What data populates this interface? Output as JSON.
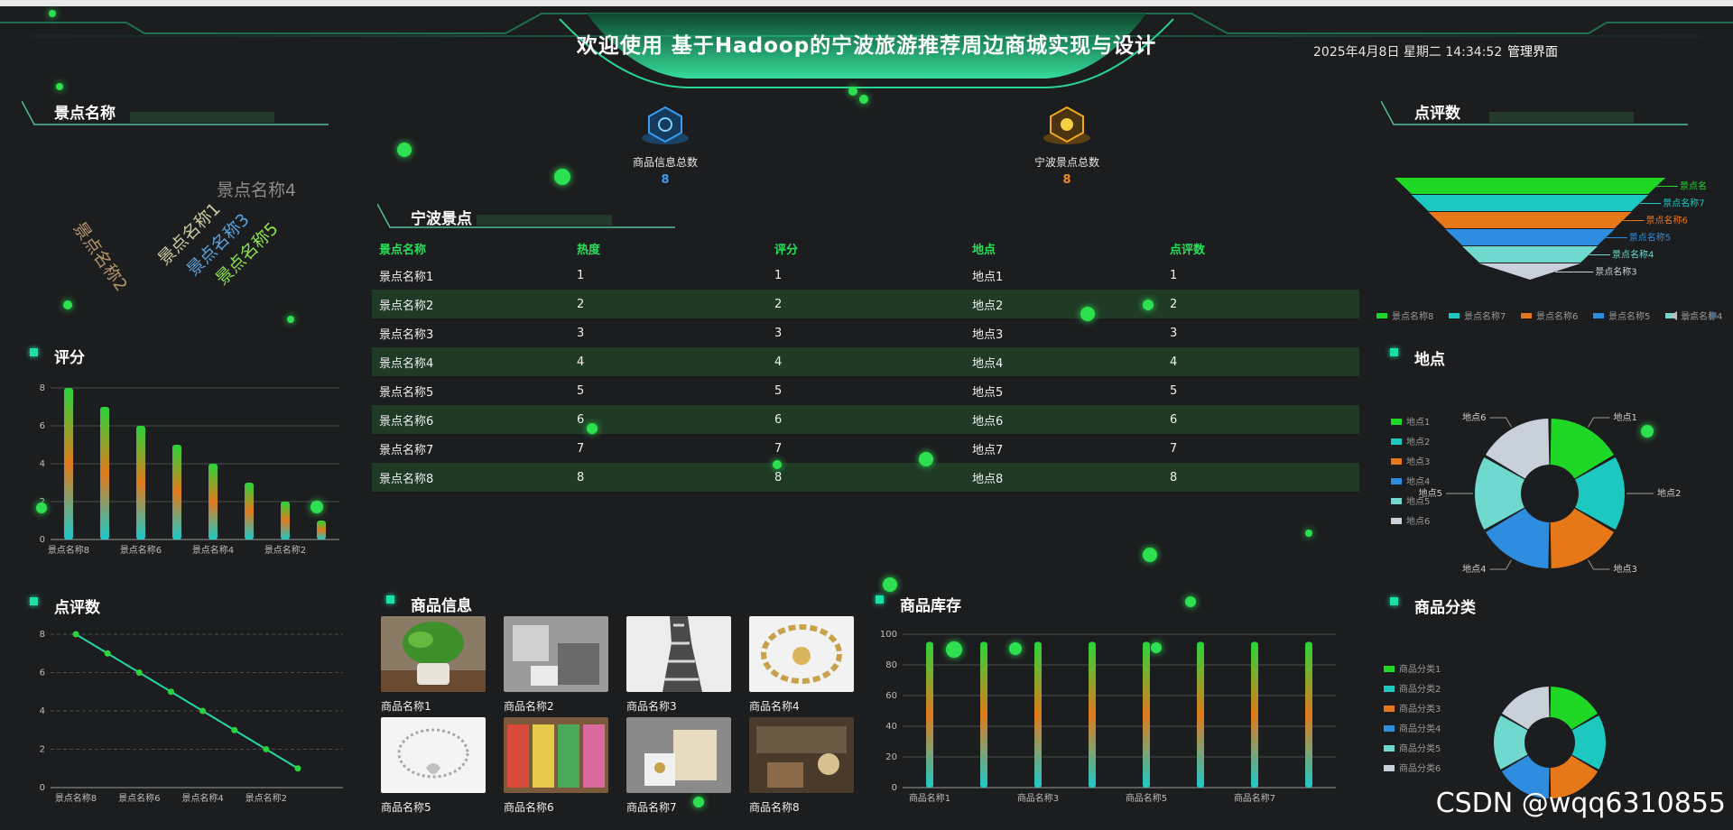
{
  "header": {
    "title": "欢迎使用 基于Hadoop的宁波旅游推荐周边商城实现与设计",
    "datetime": "2025年4月8日 星期二 14:34:52",
    "admin_link": "管理界面"
  },
  "panels": {
    "spot_name": "景点名称",
    "rating": "评分",
    "review_count_left": "点评数",
    "ningbo_spots": "宁波景点",
    "goods_info": "商品信息",
    "goods_stock": "商品库存",
    "review_count_right": "点评数",
    "location": "地点",
    "goods_category": "商品分类"
  },
  "stats": [
    {
      "label": "商品信息总数",
      "value": "8",
      "color": "#3a9cf0",
      "icon": "goods-hex-icon"
    },
    {
      "label": "宁波景点总数",
      "value": "8",
      "color": "#f08a1c",
      "icon": "spot-hex-icon"
    }
  ],
  "wordcloud": [
    {
      "text": "景点名称4",
      "color": "#8c8c8c"
    },
    {
      "text": "景点名称2",
      "color": "#b59468"
    },
    {
      "text": "景点名称1",
      "color": "#c9c9a0"
    },
    {
      "text": "景点名称3",
      "color": "#5aa0d8"
    },
    {
      "text": "景点名称5",
      "color": "#8ce04c"
    }
  ],
  "table": {
    "headers": [
      "景点名称",
      "热度",
      "评分",
      "地点",
      "点评数"
    ],
    "rows": [
      [
        "景点名称1",
        "1",
        "1",
        "地点1",
        "1"
      ],
      [
        "景点名称2",
        "2",
        "2",
        "地点2",
        "2"
      ],
      [
        "景点名称3",
        "3",
        "3",
        "地点3",
        "3"
      ],
      [
        "景点名称4",
        "4",
        "4",
        "地点4",
        "4"
      ],
      [
        "景点名称5",
        "5",
        "5",
        "地点5",
        "5"
      ],
      [
        "景点名称6",
        "6",
        "6",
        "地点6",
        "6"
      ],
      [
        "景点名称7",
        "7",
        "7",
        "地点7",
        "7"
      ],
      [
        "景点名称8",
        "8",
        "8",
        "地点8",
        "8"
      ]
    ]
  },
  "goods": [
    {
      "name": "商品名称1",
      "img": "plant"
    },
    {
      "name": "商品名称2",
      "img": "gray-photo"
    },
    {
      "name": "商品名称3",
      "img": "dress"
    },
    {
      "name": "商品名称4",
      "img": "bracelet-gold"
    },
    {
      "name": "商品名称5",
      "img": "bracelet-silver"
    },
    {
      "name": "商品名称6",
      "img": "market"
    },
    {
      "name": "商品名称7",
      "img": "box"
    },
    {
      "name": "商品名称8",
      "img": "shop"
    }
  ],
  "chart_data": [
    {
      "id": "rating-bar",
      "type": "bar",
      "categories": [
        "景点名称8",
        "景点名称7",
        "景点名称6",
        "景点名称5",
        "景点名称4",
        "景点名称3",
        "景点名称2",
        "景点名称1"
      ],
      "values": [
        8,
        7,
        6,
        5,
        4,
        3,
        2,
        1
      ],
      "xtick_labels": [
        "景点名称8",
        "景点名称6",
        "景点名称4",
        "景点名称2"
      ],
      "yticks": [
        "0",
        "2",
        "4",
        "6",
        "8"
      ],
      "ylim": [
        0,
        8
      ]
    },
    {
      "id": "review-line",
      "type": "line",
      "categories": [
        "景点名称8",
        "景点名称7",
        "景点名称6",
        "景点名称5",
        "景点名称4",
        "景点名称3",
        "景点名称2",
        "景点名称1"
      ],
      "values": [
        8,
        7,
        6,
        5,
        4,
        3,
        2,
        1
      ],
      "xtick_labels": [
        "景点名称8",
        "景点名称6",
        "景点名称4",
        "景点名称2"
      ],
      "yticks": [
        "0",
        "2",
        "4",
        "6",
        "8"
      ],
      "ylim": [
        0,
        8
      ]
    },
    {
      "id": "stock-bar",
      "type": "bar",
      "categories": [
        "商品名称1",
        "商品名称2",
        "商品名称3",
        "商品名称4",
        "商品名称5",
        "商品名称6",
        "商品名称7",
        "商品名称8"
      ],
      "values": [
        95,
        95,
        95,
        95,
        95,
        95,
        95,
        95
      ],
      "xtick_labels": [
        "商品名称1",
        "商品名称3",
        "商品名称5",
        "商品名称7"
      ],
      "yticks": [
        "0",
        "20",
        "40",
        "60",
        "80",
        "100"
      ],
      "ylim": [
        0,
        100
      ]
    },
    {
      "id": "review-funnel",
      "type": "funnel",
      "categories": [
        "景点名称8",
        "景点名称7",
        "景点名称6",
        "景点名称5",
        "景点名称4",
        "景点名称3"
      ],
      "values": [
        8,
        7,
        6,
        5,
        4,
        3
      ],
      "labels": [
        "景点名",
        "景点名称7",
        "景点名称6",
        "景点名称5",
        "景点名称4",
        "景点名称3"
      ],
      "legend": [
        "景点名称8",
        "景点名称7",
        "景点名称6",
        "景点名称5",
        "景点名称4"
      ],
      "pager": "1/2",
      "colors": [
        "#1fd826",
        "#1cc8c0",
        "#e6781a",
        "#2f8de0",
        "#6fd8cf",
        "#c8d0da"
      ]
    },
    {
      "id": "location-donut",
      "type": "pie",
      "categories": [
        "地点1",
        "地点2",
        "地点3",
        "地点4",
        "地点5",
        "地点6"
      ],
      "values": [
        1,
        1,
        1,
        1,
        1,
        1
      ],
      "colors": [
        "#1fd826",
        "#1cc8c0",
        "#e6781a",
        "#2f8de0",
        "#6fd8cf",
        "#c8d0da"
      ]
    },
    {
      "id": "category-donut",
      "type": "pie",
      "categories": [
        "商品分类1",
        "商品分类2",
        "商品分类3",
        "商品分类4",
        "商品分类5",
        "商品分类6"
      ],
      "values": [
        1,
        1,
        1,
        1,
        1,
        1
      ],
      "colors": [
        "#1fd826",
        "#1cc8c0",
        "#e6781a",
        "#2f8de0",
        "#6fd8cf",
        "#c8d0da"
      ]
    }
  ],
  "watermark": "CSDN @wqq6310855"
}
